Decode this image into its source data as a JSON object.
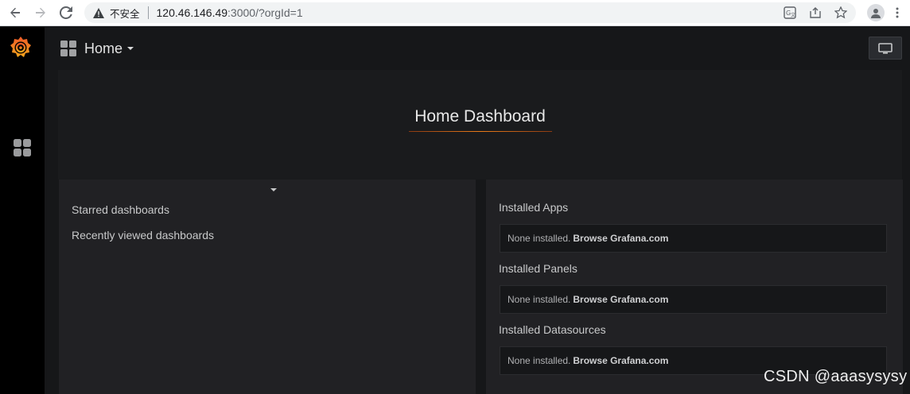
{
  "browser": {
    "insecure_label": "不安全",
    "url_host": "120.46.146.49",
    "url_rest": ":3000/?orgId=1"
  },
  "navbar": {
    "title": "Home"
  },
  "dashboard": {
    "title": "Home Dashboard"
  },
  "left_panel": {
    "links": [
      "Starred dashboards",
      "Recently viewed dashboards"
    ]
  },
  "right_panel": {
    "sections": [
      {
        "label": "Installed Apps",
        "none_text": "None installed.",
        "browse_text": "Browse Grafana.com"
      },
      {
        "label": "Installed Panels",
        "none_text": "None installed.",
        "browse_text": "Browse Grafana.com"
      },
      {
        "label": "Installed Datasources",
        "none_text": "None installed.",
        "browse_text": "Browse Grafana.com"
      }
    ]
  },
  "watermark": "CSDN @aaasysysy",
  "colors": {
    "accent": "#eb7b18",
    "sidebar": "#000000",
    "background": "#161719",
    "panel": "#212124"
  },
  "icons": {
    "back": "arrow-left-icon",
    "forward": "arrow-right-icon",
    "reload": "reload-icon",
    "warning": "warning-triangle-icon",
    "translate": "translate-icon",
    "share": "share-icon",
    "star": "star-icon",
    "profile": "profile-icon",
    "menu": "kebab-menu-icon",
    "grafana": "grafana-logo-icon",
    "dashboards": "dashboards-grid-icon",
    "tv": "tv-monitor-icon"
  }
}
